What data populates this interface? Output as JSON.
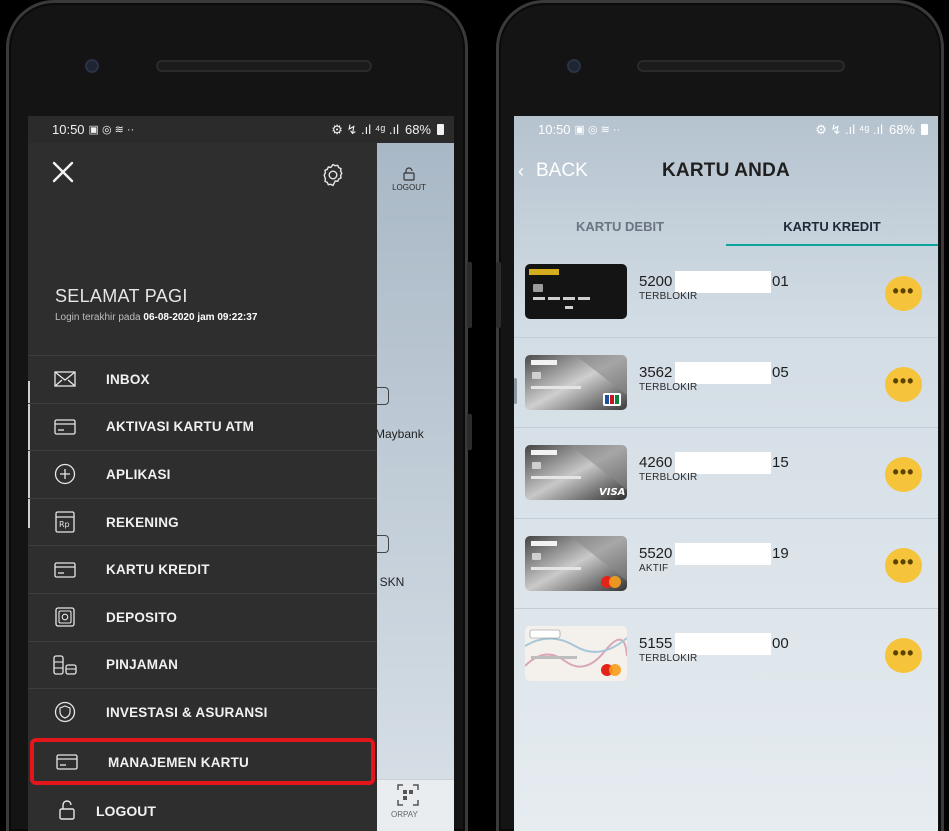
{
  "left_phone": {
    "status_bar": {
      "time": "10:50",
      "icons": "▣ ◎ ≋ ··",
      "signal": "⚙ ↯ .ıl ⁴ᵍ .ıl",
      "battery": "68%"
    },
    "drawer": {
      "greeting": "SELAMAT PAGI",
      "last_login_prefix": "Login terakhir pada",
      "last_login_value": "06-08-2020 jam 09:22:37",
      "menu_items": [
        {
          "label": "INBOX",
          "icon": "mail-icon"
        },
        {
          "label": "AKTIVASI KARTU ATM",
          "icon": "card-icon"
        },
        {
          "label": "APLIKASI",
          "icon": "plus-circle-icon"
        },
        {
          "label": "REKENING",
          "icon": "rupiah-icon"
        },
        {
          "label": "KARTU KREDIT",
          "icon": "credit-card-icon"
        },
        {
          "label": "DEPOSITO",
          "icon": "safe-icon"
        },
        {
          "label": "PINJAMAN",
          "icon": "coins-icon"
        },
        {
          "label": "INVESTASI & ASURANSI",
          "icon": "shield-icon"
        },
        {
          "label": "MANAJEMEN KARTU",
          "icon": "card-manage-icon",
          "highlighted": true
        }
      ],
      "logout_label": "LOGOUT"
    },
    "peek": {
      "logout_label": "LOGOUT",
      "maybank_label": "Maybank",
      "skn_label": "/ SKN",
      "qr_label": "ORPAY"
    }
  },
  "right_phone": {
    "status_bar": {
      "time": "10:50",
      "icons": "▣ ◎ ≋ ··",
      "signal": "⚙ ↯ .ıl ⁴ᵍ .ıl",
      "battery": "68%"
    },
    "back_label": "BACK",
    "title": "KARTU ANDA",
    "tabs": [
      {
        "label": "KARTU DEBIT",
        "active": false
      },
      {
        "label": "KARTU KREDIT",
        "active": true
      }
    ],
    "cards": [
      {
        "prefix": "5200",
        "suffix": "01",
        "status": "TERBLOKIR",
        "card_style": "black-gold"
      },
      {
        "prefix": "3562",
        "suffix": "05",
        "status": "TERBLOKIR",
        "card_style": "silver-jcb"
      },
      {
        "prefix": "4260",
        "suffix": "15",
        "status": "TERBLOKIR",
        "card_style": "silver-visa"
      },
      {
        "prefix": "5520",
        "suffix": "19",
        "status": "AKTIF",
        "card_style": "silver-mastercard"
      },
      {
        "prefix": "5155",
        "suffix": "00",
        "status": "TERBLOKIR",
        "card_style": "white-mastercard"
      }
    ],
    "more_label": "•••",
    "accent_color": "#0ea59f",
    "more_button_color": "#f6c43a"
  }
}
